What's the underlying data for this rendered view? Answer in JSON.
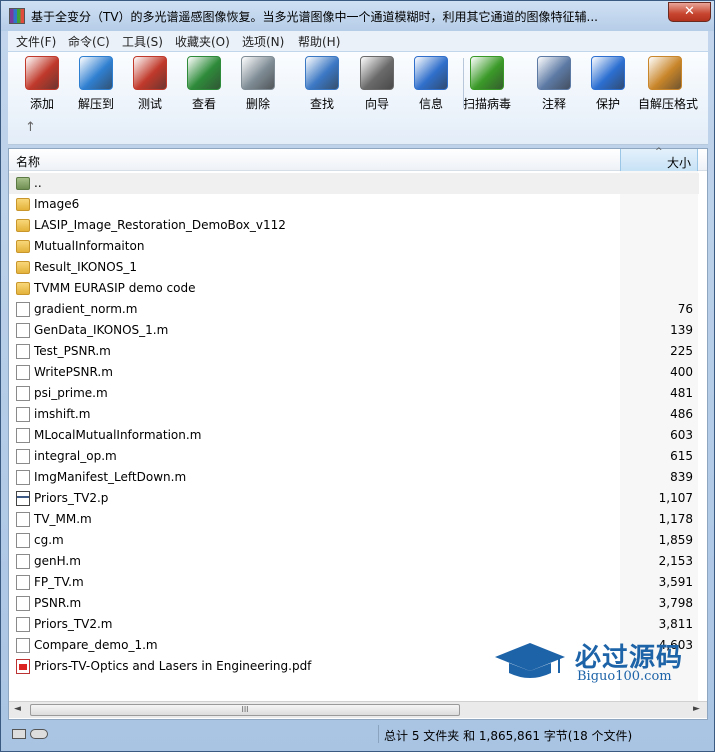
{
  "window": {
    "title": "基于全变分（TV）的多光谱遥感图像恢复。当多光谱图像中一个通道模糊时，利用其它通道的图像特征辅...",
    "close_label": "✕"
  },
  "menu": [
    "文件(F)",
    "命令(C)",
    "工具(S)",
    "收藏夹(O)",
    "选项(N)",
    "帮助(H)"
  ],
  "toolbar": {
    "buttons": [
      {
        "label": "添加",
        "icon": "add-archive-icon",
        "color": "#c0392b"
      },
      {
        "label": "解压到",
        "icon": "extract-folder-icon",
        "color": "#2f7fd1"
      },
      {
        "label": "测试",
        "icon": "test-clipboard-icon",
        "color": "#c0392b"
      },
      {
        "label": "查看",
        "icon": "view-book-icon",
        "color": "#2e8b3a"
      },
      {
        "label": "删除",
        "icon": "trash-icon",
        "color": "#7f8c95"
      },
      {
        "label": "查找",
        "icon": "find-magnifier-icon",
        "color": "#3b78c4"
      },
      {
        "label": "向导",
        "icon": "wizard-wand-icon",
        "color": "#6a6a6a"
      },
      {
        "label": "信息",
        "icon": "info-icon",
        "color": "#2f6fcb"
      },
      {
        "label": "扫描病毒",
        "icon": "virus-scan-icon",
        "color": "#3a9a28"
      },
      {
        "label": "注释",
        "icon": "comment-icon",
        "color": "#5d7aa5"
      },
      {
        "label": "保护",
        "icon": "shield-icon",
        "color": "#2c6fd1"
      },
      {
        "label": "自解压格式",
        "icon": "sfx-box-icon",
        "color": "#c9862a"
      }
    ],
    "up_arrow": "↑"
  },
  "list": {
    "col_name": "名称",
    "col_size": "大小",
    "sort_indicator": "^",
    "rows": [
      {
        "name": "..",
        "size": "",
        "type": "up"
      },
      {
        "name": "Image6",
        "size": "",
        "type": "folder"
      },
      {
        "name": "LASIP_Image_Restoration_DemoBox_v112",
        "size": "",
        "type": "folder"
      },
      {
        "name": "MutualInformaiton",
        "size": "",
        "type": "folder"
      },
      {
        "name": "Result_IKONOS_1",
        "size": "",
        "type": "folder"
      },
      {
        "name": "TVMM EURASIP demo code",
        "size": "",
        "type": "folder"
      },
      {
        "name": "gradient_norm.m",
        "size": "76",
        "type": "file"
      },
      {
        "name": "GenData_IKONOS_1.m",
        "size": "139",
        "type": "file"
      },
      {
        "name": "Test_PSNR.m",
        "size": "225",
        "type": "file"
      },
      {
        "name": "WritePSNR.m",
        "size": "400",
        "type": "file"
      },
      {
        "name": "psi_prime.m",
        "size": "481",
        "type": "file"
      },
      {
        "name": "imshift.m",
        "size": "486",
        "type": "file"
      },
      {
        "name": "MLocalMutualInformation.m",
        "size": "603",
        "type": "file"
      },
      {
        "name": "integral_op.m",
        "size": "615",
        "type": "file"
      },
      {
        "name": "ImgManifest_LeftDown.m",
        "size": "839",
        "type": "file"
      },
      {
        "name": "Priors_TV2.p",
        "size": "1,107",
        "type": "pfile"
      },
      {
        "name": "TV_MM.m",
        "size": "1,178",
        "type": "file"
      },
      {
        "name": "cg.m",
        "size": "1,859",
        "type": "file"
      },
      {
        "name": "genH.m",
        "size": "2,153",
        "type": "file"
      },
      {
        "name": "FP_TV.m",
        "size": "3,591",
        "type": "file"
      },
      {
        "name": "PSNR.m",
        "size": "3,798",
        "type": "file"
      },
      {
        "name": "Priors_TV2.m",
        "size": "3,811",
        "type": "file"
      },
      {
        "name": "Compare_demo_1.m",
        "size": "4,603",
        "type": "file"
      },
      {
        "name": "Priors-TV-Optics and Lasers in Engineering.pdf",
        "size": "",
        "type": "pdf"
      }
    ]
  },
  "scrollbar": {
    "left": "◄",
    "right": "►",
    "grip": "III"
  },
  "status": {
    "text": "总计 5 文件夹 和 1,865,861 字节(18 个文件)"
  },
  "watermark": {
    "title": "必过源码",
    "url": "Biguo100.com"
  }
}
